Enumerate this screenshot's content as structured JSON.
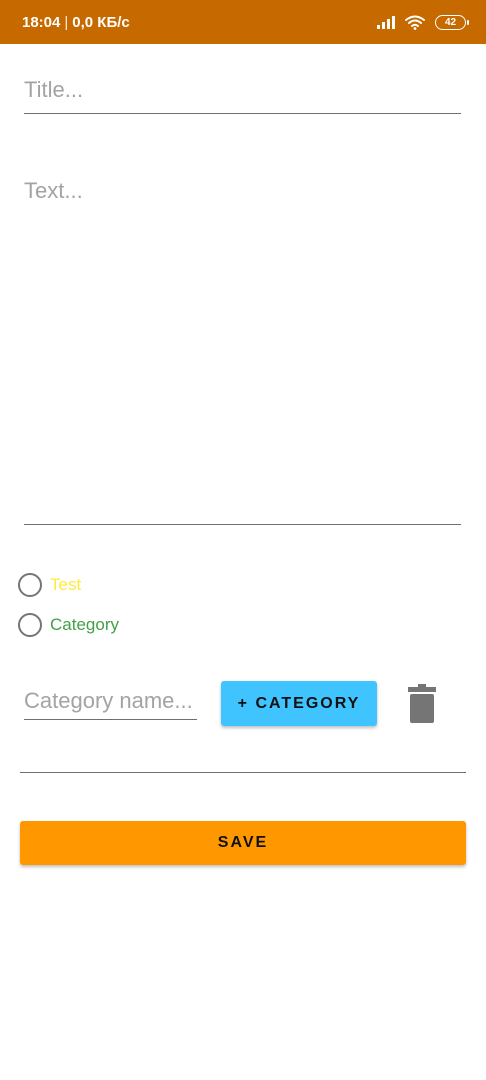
{
  "status_bar": {
    "time": "18:04",
    "separator": "|",
    "net_speed": "0,0 КБ/с",
    "battery": "42",
    "icons": [
      "signal-icon",
      "wifi-icon",
      "battery-icon"
    ],
    "background": "#c66a00"
  },
  "form": {
    "title_placeholder": "Title...",
    "text_placeholder": "Text...",
    "category_name_placeholder": "Category name..."
  },
  "categories": [
    {
      "label": "Test",
      "color": "#ffeb3b",
      "selected": false
    },
    {
      "label": "Category",
      "color": "#43a047",
      "selected": false
    }
  ],
  "buttons": {
    "add_category_label": "+ CATEGORY",
    "add_category_color": "#40c4ff",
    "delete_icon": "trash-icon",
    "save_label": "SAVE",
    "save_color": "#ff9800"
  }
}
